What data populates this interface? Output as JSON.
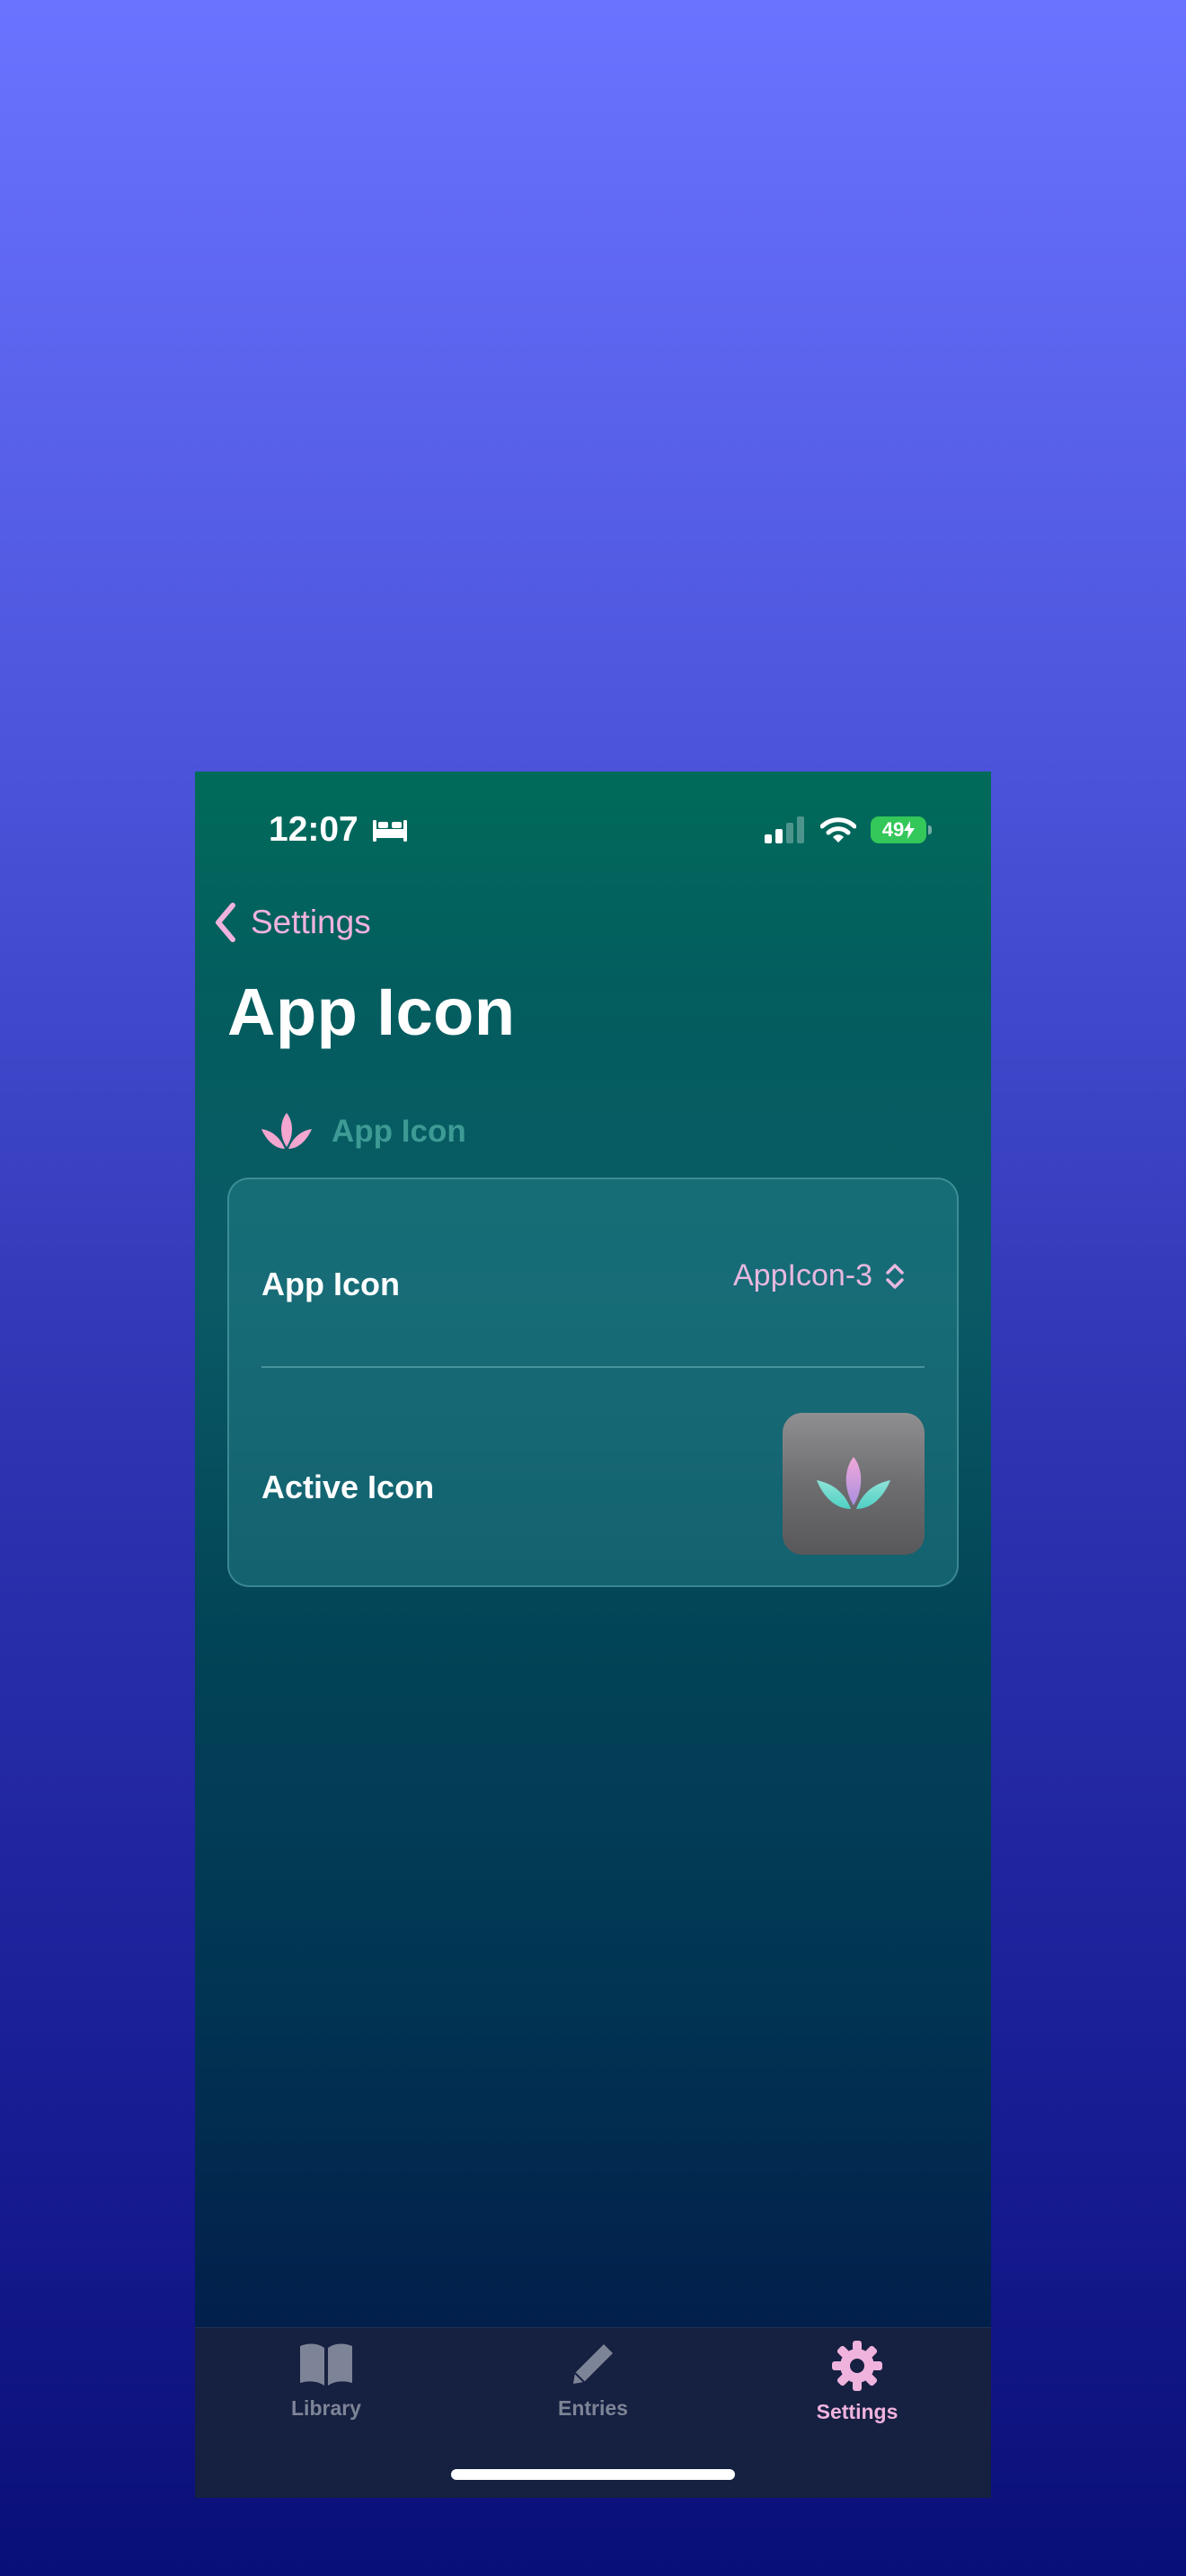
{
  "status_bar": {
    "time": "12:07",
    "battery": "49",
    "focus_icon": "bed-icon",
    "signal_icon": "cellular-signal-icon",
    "wifi_icon": "wifi-icon",
    "battery_color": "#34c759"
  },
  "nav": {
    "back_label": "Settings",
    "back_icon": "chevron-left-icon",
    "title": "App Icon"
  },
  "section": {
    "header": "App Icon",
    "header_icon": "lotus-icon"
  },
  "rows": {
    "app_icon_label": "App Icon",
    "app_icon_value": "AppIcon-3",
    "picker_icon": "chevron-up-down-icon",
    "active_icon_label": "Active Icon"
  },
  "tabs": [
    {
      "label": "Library",
      "icon": "book-icon",
      "active": false
    },
    {
      "label": "Entries",
      "icon": "pencil-icon",
      "active": false
    },
    {
      "label": "Settings",
      "icon": "gear-icon",
      "active": true
    }
  ],
  "colors": {
    "accent": "#f0b3de",
    "section_header": "#3d9a94",
    "tab_inactive": "#7d8497"
  }
}
